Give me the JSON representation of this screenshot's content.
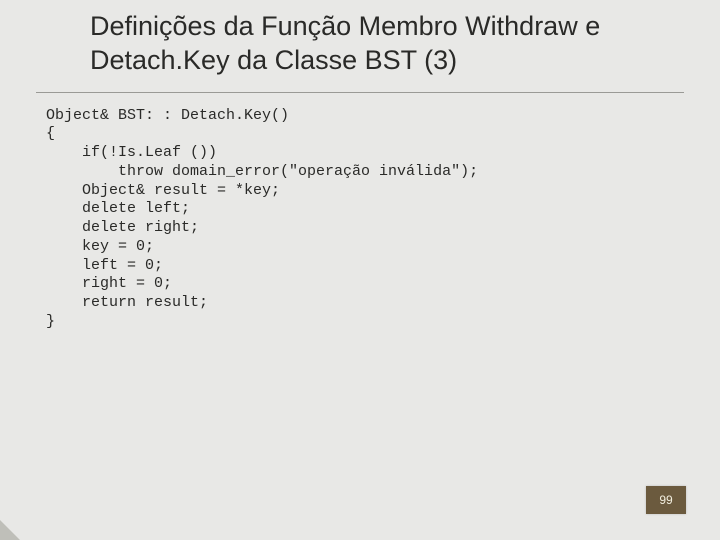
{
  "title": "Definições da Função Membro Withdraw e Detach.Key da Classe BST (3)",
  "code": "Object& BST: : Detach.Key()\n{\n    if(!Is.Leaf ())\n        throw domain_error(\"operação inválida\");\n    Object& result = *key;\n    delete left;\n    delete right;\n    key = 0;\n    left = 0;\n    right = 0;\n    return result;\n}",
  "page_number": "99"
}
